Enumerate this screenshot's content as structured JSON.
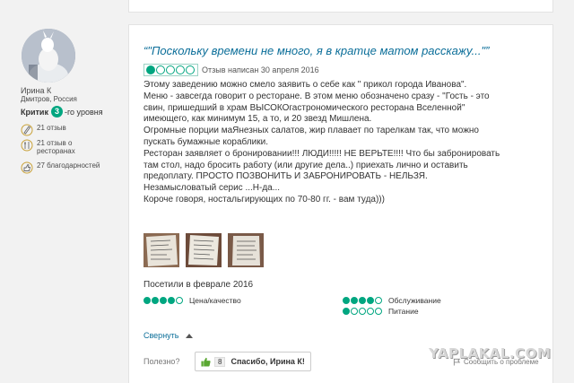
{
  "user": {
    "name": "Ирина К",
    "location": "Дмитров, Россия",
    "critic_label": "Критик",
    "level": "3",
    "level_suffix": "-го уровня",
    "stats": [
      {
        "icon": "pen-icon",
        "text": "21 отзыв"
      },
      {
        "icon": "restaurant-review-icon",
        "text": "21 отзыв о ресторанах"
      },
      {
        "icon": "thumbs-up-icon",
        "text": "27 благодарностей"
      }
    ]
  },
  "review": {
    "title": "“\"Поскольку времени не много, я в кратце матом расскажу...\"”",
    "rating": 1,
    "rating_max": 5,
    "date": "Отзыв написан 30 апреля 2016",
    "body_lines": [
      "Этому заведению можно смело заявить о себе как \" прикол города Иванова\".",
      "Меню - завсегда говорит о ресторане. В этом меню обозначено сразу - \"Гость - это",
      "свин, пришедший в храм ВЫСОКОгастрономического ресторана Вселенной\"",
      "имеющего, как минимум 15, а то, и 20 звезд Мишлена.",
      "Огромные порции маЯнезных салатов, жир плавает по тарелкам так, что можно",
      "пускать бумажные кораблики.",
      "Ресторан заявляет о бронировании!!! ЛЮДИ!!!!! НЕ ВЕРЬТЕ!!!! Что бы забронировать",
      "там стол, надо бросить работу (или другие дела..) приехать лично и оставить",
      "предоплату. ПРОСТО ПОЗВОНИТЬ И ЗАБРОНИРОВАТЬ - НЕЛЬЗЯ.",
      "Незамысловатый серис ...Н-да...",
      "Короче говоря, ностальгирующих по 70-80 гг. - вам туда)))"
    ],
    "visited": "Посетили в феврале 2016",
    "sub_ratings": [
      {
        "label": "Цена/качество",
        "value": 4
      },
      {
        "label": "Обслуживание",
        "value": 4
      },
      {
        "label": "Питание",
        "value": 1
      }
    ],
    "collapse_label": "Свернуть",
    "helpful_label": "Полезно?",
    "thanks_count": "8",
    "thanks_label": "Спасибо, Ирина К!",
    "report_label": "Сообщить о проблеме"
  },
  "watermark": "YAPLAKAL.COM",
  "colors": {
    "accent": "#00a680",
    "link": "#0b6e99"
  }
}
